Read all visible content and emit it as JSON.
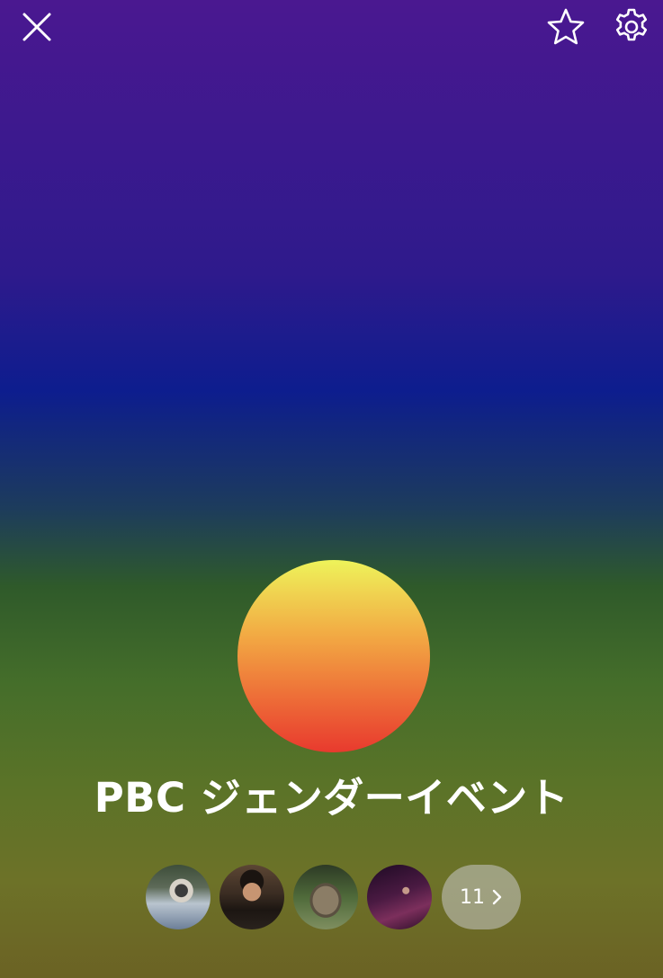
{
  "header": {
    "close_icon": "close-icon",
    "favorite_icon": "star-icon",
    "settings_icon": "gear-icon"
  },
  "group": {
    "name": "PBC ジェンダーイベント",
    "avatar_gradient": [
      "#eef35a",
      "#f2a843",
      "#ee7038",
      "#e83a2e"
    ]
  },
  "members": {
    "avatars": [
      {
        "id": "member-1"
      },
      {
        "id": "member-2"
      },
      {
        "id": "member-3"
      },
      {
        "id": "member-4"
      }
    ],
    "count_label": "11",
    "chevron_icon": "chevron-right-icon"
  },
  "colors": {
    "background_top": "#4a1890",
    "background_mid": "#0d1d8e",
    "background_bottom": "#6b6224",
    "text": "#ffffff"
  }
}
